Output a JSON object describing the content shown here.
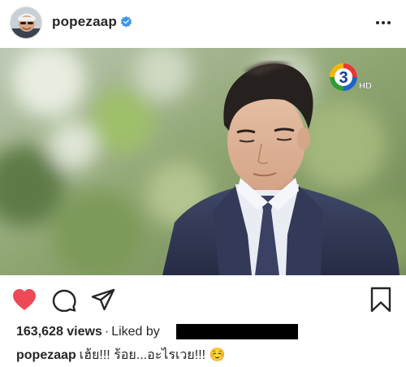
{
  "header": {
    "username": "popezaap",
    "verified": true,
    "icons": {
      "avatar": "avatar-photo",
      "verified": "verified-badge-icon",
      "more": "more-options-icon"
    }
  },
  "post": {
    "image_subject": "photo",
    "channel_logo": "3 HD",
    "channel_logo_text": {
      "number": "3",
      "suffix": "HD"
    }
  },
  "actions": {
    "icons": [
      "heart-icon",
      "comment-icon",
      "share-icon",
      "bookmark-icon"
    ],
    "liked": true
  },
  "stats": {
    "views": "163,628 views",
    "separator": "·",
    "liked_by_label": "Liked by"
  },
  "caption": {
    "username": "popezaap",
    "text": "เฮ้ย!!! ร้อย...อะไรเวย!!! ☺️"
  },
  "colors": {
    "like_red": "#ed4956",
    "verified_blue": "#3897f0",
    "text": "#262626",
    "channel_logo_green": "#2f9b3a",
    "channel_logo_red": "#e53935",
    "channel_logo_blue": "#1e63c6"
  }
}
